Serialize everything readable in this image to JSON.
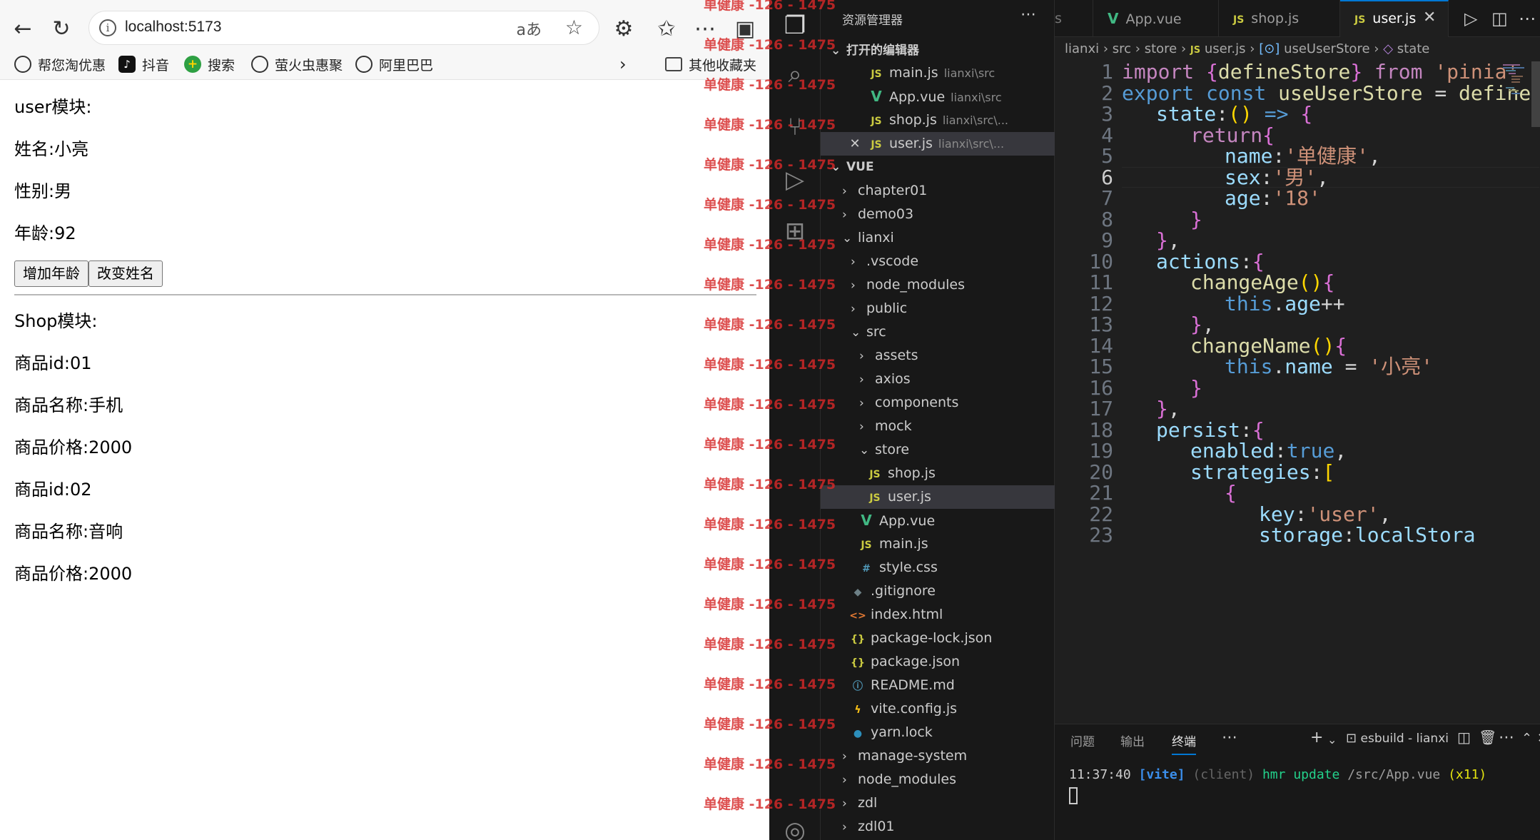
{
  "browser": {
    "url": "localhost:5173",
    "read_aloud": "aあ",
    "bookmarks": [
      "帮您淘优惠",
      "抖音",
      "搜索",
      "萤火虫惠聚",
      "阿里巴巴"
    ],
    "other_bookmarks": "其他收藏夹",
    "page": {
      "user_heading": "user模块:",
      "user_name": "姓名:小亮",
      "user_sex": "性别:男",
      "user_age": "年龄:92",
      "btn_add_age": "增加年龄",
      "btn_change_name": "改变姓名",
      "shop_heading": "Shop模块:",
      "products": [
        {
          "id": "商品id:01",
          "name": "商品名称:手机",
          "price": "商品价格:2000"
        },
        {
          "id": "商品id:02",
          "name": "商品名称:音响",
          "price": "商品价格:2000"
        }
      ]
    },
    "watermark": "单健康 -126 - 1475"
  },
  "vscode": {
    "explorer_title": "资源管理器",
    "open_editors_title": "打开的编辑器",
    "open_editors": [
      {
        "name": "main.js",
        "path": "lianxi\\src",
        "icon": "JS"
      },
      {
        "name": "App.vue",
        "path": "lianxi\\src",
        "icon": "V"
      },
      {
        "name": "shop.js",
        "path": "lianxi\\src\\...",
        "icon": "JS"
      },
      {
        "name": "user.js",
        "path": "lianxi\\src\\...",
        "icon": "JS"
      }
    ],
    "workspace_title": "VUE",
    "tree": [
      {
        "name": "chapter01",
        "chev": "›"
      },
      {
        "name": "demo03",
        "chev": "›"
      },
      {
        "name": "lianxi",
        "chev": "⌄"
      },
      {
        "name": ".vscode",
        "chev": "›"
      },
      {
        "name": "node_modules",
        "chev": "›"
      },
      {
        "name": "public",
        "chev": "›"
      },
      {
        "name": "src",
        "chev": "⌄"
      },
      {
        "name": "assets",
        "chev": "›"
      },
      {
        "name": "axios",
        "chev": "›"
      },
      {
        "name": "components",
        "chev": "›"
      },
      {
        "name": "mock",
        "chev": "›"
      },
      {
        "name": "store",
        "chev": "⌄"
      },
      {
        "name": "shop.js",
        "icon": "JS"
      },
      {
        "name": "user.js",
        "icon": "JS"
      },
      {
        "name": "App.vue",
        "icon": "V"
      },
      {
        "name": "main.js",
        "icon": "JS"
      },
      {
        "name": "style.css",
        "icon": "#"
      },
      {
        "name": ".gitignore",
        "icon": "◆"
      },
      {
        "name": "index.html",
        "icon": "<>"
      },
      {
        "name": "package-lock.json",
        "icon": "{}"
      },
      {
        "name": "package.json",
        "icon": "{}"
      },
      {
        "name": "README.md",
        "icon": "ⓘ"
      },
      {
        "name": "vite.config.js",
        "icon": "ϟ"
      },
      {
        "name": "yarn.lock",
        "icon": "🧶"
      },
      {
        "name": "manage-system",
        "chev": "›"
      },
      {
        "name": "node_modules",
        "chev": "›"
      },
      {
        "name": "zdl",
        "chev": "›"
      },
      {
        "name": "zdl01",
        "chev": "›"
      }
    ],
    "tabs": [
      {
        "name": "App.vue",
        "icon": "V"
      },
      {
        "name": "shop.js",
        "icon": "JS"
      },
      {
        "name": "user.js",
        "icon": "JS"
      }
    ],
    "tab_prefix": "s",
    "breadcrumb": [
      "lianxi",
      "src",
      "store",
      "user.js",
      "useUserStore",
      "state"
    ],
    "code_lines": [
      "import {defineStore} from 'pinia'",
      "export const useUserStore = define",
      "state:() => {",
      "return{",
      "name:'单健康',",
      "sex:'男',",
      "age:'18'",
      "}",
      "},",
      "actions:{",
      "changeAge(){",
      "this.age++",
      "},",
      "changeName(){",
      "this.name = '小亮'",
      "}",
      "},",
      "persist:{",
      "enabled:true,",
      "strategies:[",
      "{",
      "key:'user',",
      "storage:localStora"
    ],
    "current_line": 6,
    "panel": {
      "tabs": [
        "问题",
        "输出",
        "终端"
      ],
      "active_tab": "终端",
      "terminal_name": "esbuild - lianxi",
      "terminal_time": "11:37:40",
      "terminal_tag": "[vite]",
      "terminal_client": "(client)",
      "terminal_hmr": "hmr update",
      "terminal_path": "/src/App.vue",
      "terminal_count": "(x11)"
    }
  }
}
